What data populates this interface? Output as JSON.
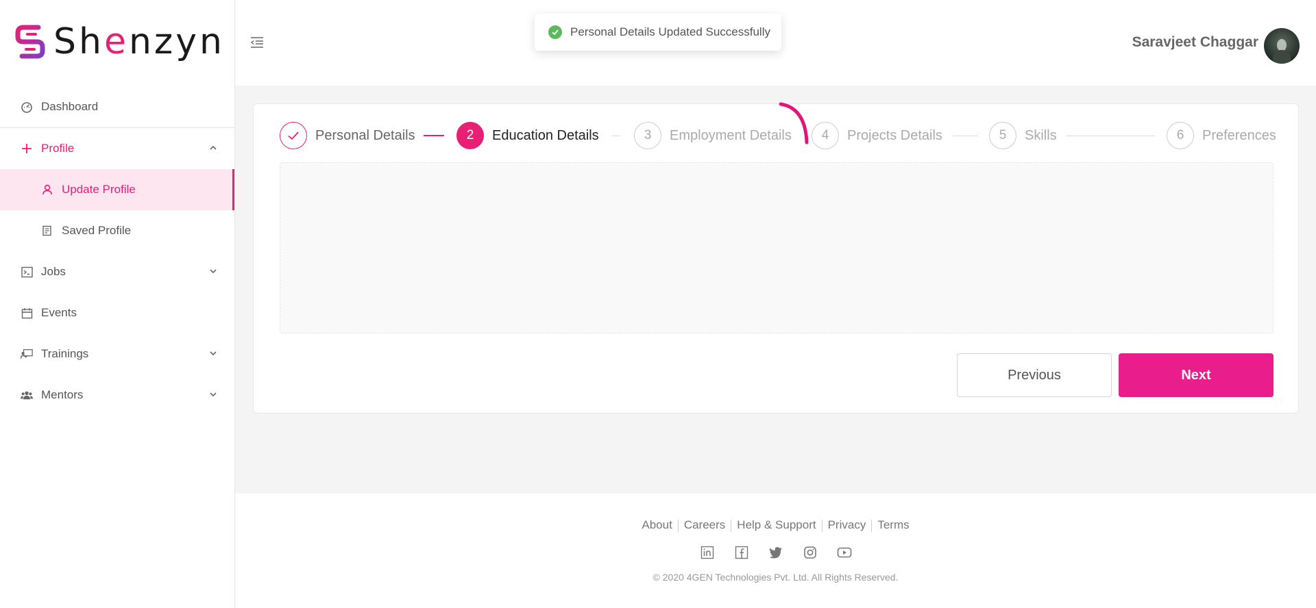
{
  "brand": {
    "name_prefix": "Sh",
    "name_highlight": "e",
    "name_suffix": "nzyn"
  },
  "colors": {
    "accent": "#e91e75",
    "button_primary": "#e91e8c",
    "success": "#5cb85c"
  },
  "sidebar": {
    "items": [
      {
        "label": "Dashboard",
        "icon": "dashboard-icon"
      },
      {
        "label": "Profile",
        "icon": "plus-icon",
        "expanded": true
      },
      {
        "label": "Update Profile",
        "icon": "user-icon",
        "active": true
      },
      {
        "label": "Saved Profile",
        "icon": "document-icon"
      },
      {
        "label": "Jobs",
        "icon": "terminal-icon"
      },
      {
        "label": "Events",
        "icon": "calendar-icon"
      },
      {
        "label": "Trainings",
        "icon": "presentation-icon"
      },
      {
        "label": "Mentors",
        "icon": "group-icon"
      }
    ]
  },
  "header": {
    "user_name": "Saravjeet Chaggar"
  },
  "toast": {
    "message": "Personal Details Updated Successfully"
  },
  "stepper": {
    "steps": [
      {
        "number": "",
        "label": "Personal Details",
        "state": "done"
      },
      {
        "number": "2",
        "label": "Education Details",
        "state": "current"
      },
      {
        "number": "3",
        "label": "Employment Details",
        "state": "pending"
      },
      {
        "number": "4",
        "label": "Projects Details",
        "state": "pending"
      },
      {
        "number": "5",
        "label": "Skills",
        "state": "pending"
      },
      {
        "number": "6",
        "label": "Preferences",
        "state": "pending"
      }
    ]
  },
  "actions": {
    "previous_label": "Previous",
    "next_label": "Next"
  },
  "footer": {
    "links": [
      "About",
      "Careers",
      "Help & Support",
      "Privacy",
      "Terms"
    ],
    "social": [
      "linkedin-icon",
      "facebook-icon",
      "twitter-icon",
      "instagram-icon",
      "youtube-icon"
    ],
    "copyright": "© 2020 4GEN Technologies Pvt. Ltd. All Rights Reserved."
  }
}
